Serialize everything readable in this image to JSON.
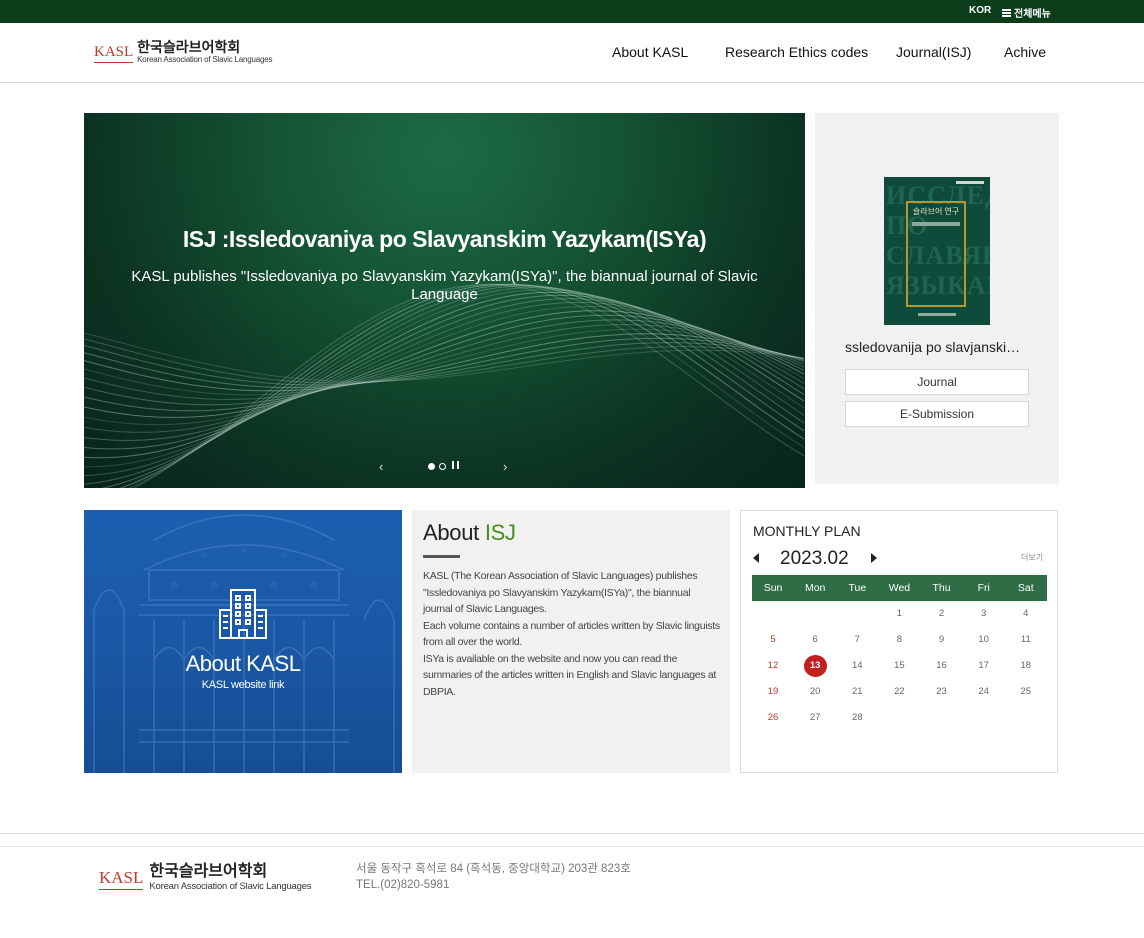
{
  "topbar": {
    "lang": "KOR",
    "all_menu": "전체메뉴"
  },
  "logo": {
    "mark": "KASL",
    "name_kr": "한국슬라브어학회",
    "name_en": "Korean Association of Slavic Languages"
  },
  "nav": [
    {
      "label": "About KASL"
    },
    {
      "label": "Research Ethics codes"
    },
    {
      "label": "Journal(ISJ)"
    },
    {
      "label": "Achive"
    }
  ],
  "banner": {
    "title": "ISJ :Issledovaniya po Slavyanskim Yazykam(ISYa)",
    "subtitle": "KASL publishes \"Issledovaniya po Slavyanskim Yazykam(ISYa)\", the biannual journal of Slavic Language",
    "prev": "‹",
    "next": "›"
  },
  "journal_box": {
    "cover_title": "슬라브어 연구",
    "cover_bg_text": "ИССЛЕДОВАНИЯ ПО СЛАВЯНСК ЯЗЫКАМ",
    "title": "ssledovanija po slavjanskim jazykam",
    "btn_journal": "Journal",
    "btn_submission": "E-Submission"
  },
  "about_kasl": {
    "title": "About KASL",
    "link": "KASL website link"
  },
  "about_isj": {
    "title_plain": "About ",
    "title_accent": "ISJ",
    "paragraphs": [
      "KASL (The Korean Association of Slavic Languages) publishes \"Issledovaniya po Slavyanskim Yazykam(ISYa)\", the biannual journal of Slavic Languages.",
      "Each volume contains a number of articles written by Slavic linguists from all over the world.",
      "ISYa is available on the website and now you can read the summaries of the articles written in English and Slavic languages at DBPIA."
    ]
  },
  "monthly_plan": {
    "title": "MONTHLY PLAN",
    "year_month": "2023.02",
    "more": "더보기",
    "weekdays": [
      "Sun",
      "Mon",
      "Tue",
      "Wed",
      "Thu",
      "Fri",
      "Sat"
    ],
    "weeks": [
      [
        "",
        "",
        "",
        "1",
        "2",
        "3",
        "4"
      ],
      [
        "5",
        "6",
        "7",
        "8",
        "9",
        "10",
        "11"
      ],
      [
        "12",
        "13",
        "14",
        "15",
        "16",
        "17",
        "18"
      ],
      [
        "19",
        "20",
        "21",
        "22",
        "23",
        "24",
        "25"
      ],
      [
        "26",
        "27",
        "28",
        "",
        "",
        "",
        ""
      ]
    ],
    "today": "13"
  },
  "footer": {
    "address": "서울 동작구 흑석로 84 (흑석동, 중앙대학교) 203관 823호",
    "tel": "TEL.(02)820-5981"
  },
  "colors": {
    "topbar": "#0b3d1b",
    "accent_green": "#4c8c1f",
    "calendar_header": "#2f6d47",
    "logo_red": "#c0392b",
    "today_red": "#c31f1f",
    "kasl_blue": "#1a58a5"
  }
}
